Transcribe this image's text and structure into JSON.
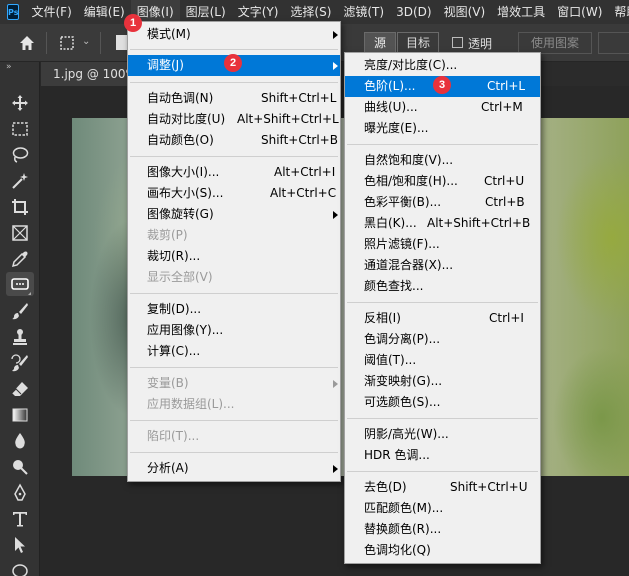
{
  "app": {
    "logo": "Ps"
  },
  "menubar": {
    "items": [
      "文件(F)",
      "编辑(E)",
      "图像(I)",
      "图层(L)",
      "文字(Y)",
      "选择(S)",
      "滤镜(T)",
      "3D(D)",
      "视图(V)",
      "增效工具",
      "窗口(W)",
      "帮助(H)"
    ],
    "active_index": 2
  },
  "options_bar": {
    "source_label": "源",
    "target_label": "目标",
    "transparent_label": "透明",
    "use_pattern_label": "使用图案"
  },
  "toolbar": {
    "tools": [
      "move-tool",
      "marquee-tool",
      "lasso-tool",
      "magic-wand-tool",
      "crop-tool",
      "frame-tool",
      "eyedropper-tool",
      "patch-tool",
      "brush-tool",
      "stamp-tool",
      "history-brush-tool",
      "eraser-tool",
      "gradient-tool",
      "blur-tool",
      "dodge-tool",
      "pen-tool",
      "type-tool",
      "path-select-tool",
      "shape-tool"
    ],
    "selected": "patch-tool"
  },
  "document_tab": {
    "label": "1.jpg @ 100%("
  },
  "image_menu": {
    "items": [
      {
        "label": "模式(M)",
        "shortcut": "",
        "submenu": true,
        "disabled": false
      },
      {
        "label": "调整(J)",
        "shortcut": "",
        "submenu": true,
        "disabled": false,
        "highlight": true
      },
      {
        "label": "自动色调(N)",
        "shortcut": "Shift+Ctrl+L",
        "disabled": false
      },
      {
        "label": "自动对比度(U)",
        "shortcut": "Alt+Shift+Ctrl+L",
        "disabled": false
      },
      {
        "label": "自动颜色(O)",
        "shortcut": "Shift+Ctrl+B",
        "disabled": false
      },
      {
        "label": "图像大小(I)...",
        "shortcut": "Alt+Ctrl+I",
        "disabled": false
      },
      {
        "label": "画布大小(S)...",
        "shortcut": "Alt+Ctrl+C",
        "disabled": false
      },
      {
        "label": "图像旋转(G)",
        "shortcut": "",
        "submenu": true,
        "disabled": false
      },
      {
        "label": "裁剪(P)",
        "shortcut": "",
        "disabled": true
      },
      {
        "label": "裁切(R)...",
        "shortcut": "",
        "disabled": false
      },
      {
        "label": "显示全部(V)",
        "shortcut": "",
        "disabled": true
      },
      {
        "label": "复制(D)...",
        "shortcut": "",
        "disabled": false
      },
      {
        "label": "应用图像(Y)...",
        "shortcut": "",
        "disabled": false
      },
      {
        "label": "计算(C)...",
        "shortcut": "",
        "disabled": false
      },
      {
        "label": "变量(B)",
        "shortcut": "",
        "submenu": true,
        "disabled": true
      },
      {
        "label": "应用数据组(L)...",
        "shortcut": "",
        "disabled": true
      },
      {
        "label": "陷印(T)...",
        "shortcut": "",
        "disabled": true
      },
      {
        "label": "分析(A)",
        "shortcut": "",
        "submenu": true,
        "disabled": false
      }
    ]
  },
  "adjust_menu": {
    "items": [
      {
        "label": "亮度/对比度(C)...",
        "shortcut": ""
      },
      {
        "label": "色阶(L)...",
        "shortcut": "Ctrl+L",
        "highlight": true
      },
      {
        "label": "曲线(U)...",
        "shortcut": "Ctrl+M"
      },
      {
        "label": "曝光度(E)...",
        "shortcut": ""
      },
      {
        "label": "自然饱和度(V)...",
        "shortcut": ""
      },
      {
        "label": "色相/饱和度(H)...",
        "shortcut": "Ctrl+U"
      },
      {
        "label": "色彩平衡(B)...",
        "shortcut": "Ctrl+B"
      },
      {
        "label": "黑白(K)...",
        "shortcut": "Alt+Shift+Ctrl+B"
      },
      {
        "label": "照片滤镜(F)...",
        "shortcut": ""
      },
      {
        "label": "通道混合器(X)...",
        "shortcut": ""
      },
      {
        "label": "颜色查找...",
        "shortcut": ""
      },
      {
        "label": "反相(I)",
        "shortcut": "Ctrl+I"
      },
      {
        "label": "色调分离(P)...",
        "shortcut": ""
      },
      {
        "label": "阈值(T)...",
        "shortcut": ""
      },
      {
        "label": "渐变映射(G)...",
        "shortcut": ""
      },
      {
        "label": "可选颜色(S)...",
        "shortcut": ""
      },
      {
        "label": "阴影/高光(W)...",
        "shortcut": ""
      },
      {
        "label": "HDR 色调...",
        "shortcut": ""
      },
      {
        "label": "去色(D)",
        "shortcut": "Shift+Ctrl+U"
      },
      {
        "label": "匹配颜色(M)...",
        "shortcut": ""
      },
      {
        "label": "替换颜色(R)...",
        "shortcut": ""
      },
      {
        "label": "色调均化(Q)",
        "shortcut": ""
      }
    ]
  },
  "step_badges": [
    "1",
    "2",
    "3"
  ],
  "colors": {
    "highlight": "#0078d7",
    "badge": "#e8323c",
    "menu_bg": "#f0f0f0"
  }
}
